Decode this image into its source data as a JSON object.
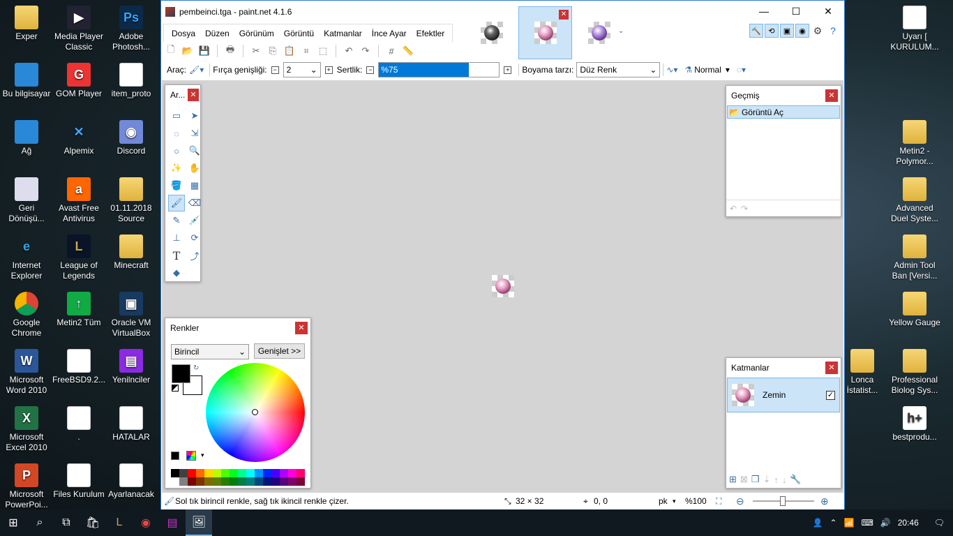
{
  "desktop_left": [
    {
      "label": "Exper",
      "icon": "folder-user-icon"
    },
    {
      "label": "Media Player Classic",
      "icon": "media-player-icon"
    },
    {
      "label": "Adobe Photosh...",
      "icon": "photoshop-icon"
    },
    {
      "label": "Bu bilgisayar",
      "icon": "computer-icon"
    },
    {
      "label": "GOM Player",
      "icon": "gom-player-icon"
    },
    {
      "label": "item_proto",
      "icon": "document-icon"
    },
    {
      "label": "Ağ",
      "icon": "network-icon"
    },
    {
      "label": "Alpemix",
      "icon": "alpemix-icon"
    },
    {
      "label": "Discord",
      "icon": "discord-icon"
    },
    {
      "label": "Geri Dönüşü...",
      "icon": "recycle-bin-icon"
    },
    {
      "label": "Avast Free Antivirus",
      "icon": "avast-icon"
    },
    {
      "label": "01.11.2018 Source",
      "icon": "folder-icon"
    },
    {
      "label": "Internet Explorer",
      "icon": "ie-icon"
    },
    {
      "label": "League of Legends",
      "icon": "lol-icon"
    },
    {
      "label": "Minecraft",
      "icon": "folder-icon"
    },
    {
      "label": "Google Chrome",
      "icon": "chrome-icon"
    },
    {
      "label": "Metin2 Tüm",
      "icon": "metin2-icon"
    },
    {
      "label": "Oracle VM VirtualBox",
      "icon": "virtualbox-icon"
    },
    {
      "label": "Microsoft Word 2010",
      "icon": "word-icon"
    },
    {
      "label": "FreeBSD9.2...",
      "icon": "document-icon"
    },
    {
      "label": "Yenilnciler",
      "icon": "winrar-icon"
    },
    {
      "label": "Microsoft Excel 2010",
      "icon": "excel-icon"
    },
    {
      "label": ".",
      "icon": "document-icon"
    },
    {
      "label": "HATALAR",
      "icon": "document-icon"
    },
    {
      "label": "Microsoft PowerPoi...",
      "icon": "powerpoint-icon"
    },
    {
      "label": "Files Kurulum",
      "icon": "document-icon"
    },
    {
      "label": "Ayarlanacak",
      "icon": "document-icon"
    }
  ],
  "desktop_right": [
    {
      "label": "Uyarı [ KURULUM...",
      "icon": "document-icon"
    },
    {
      "label": "Metin2 - Polymor...",
      "icon": "folder-icon"
    },
    {
      "label": "Advanced Duel Syste...",
      "icon": "folder-icon"
    },
    {
      "label": "Admin Tool Ban [Versi...",
      "icon": "folder-icon"
    },
    {
      "label": "Yellow Gauge",
      "icon": "folder-icon"
    },
    {
      "label": "Lonca İstatist...",
      "icon": "folder-icon"
    },
    {
      "label": "Professional Biolog Sys...",
      "icon": "folder-icon"
    },
    {
      "label": "bestprodu...",
      "icon": "hplus-icon"
    }
  ],
  "window": {
    "title": "pembeinci.tga - paint.net 4.1.6",
    "minimize": "—",
    "maximize": "☐",
    "close": "✕"
  },
  "menu": [
    "Dosya",
    "Düzen",
    "Görünüm",
    "Görüntü",
    "Katmanlar",
    "İnce Ayar",
    "Efektler"
  ],
  "toolbar2": {
    "tool_label": "Araç:",
    "brush_width_label": "Fırça genişliği:",
    "brush_width_value": "2",
    "hardness_label": "Sertlik:",
    "hardness_value": "%75",
    "hardness_fraction": 0.75,
    "fill_label": "Boyama tarzı:",
    "fill_value": "Düz Renk",
    "blend_value": "Normal"
  },
  "tools_panel": {
    "title": "Ar..."
  },
  "history_panel": {
    "title": "Geçmiş",
    "items": [
      "Görüntü Aç"
    ]
  },
  "colors_panel": {
    "title": "Renkler",
    "mode": "Birincil",
    "expand": "Genişlet >>"
  },
  "layers_panel": {
    "title": "Katmanlar",
    "layers": [
      {
        "name": "Zemin",
        "visible": true
      }
    ]
  },
  "status": {
    "hint": "Sol tık birincil renkle, sağ tık ikincil renkle çizer.",
    "size": "32 × 32",
    "position": "0, 0",
    "units": "pk",
    "zoom": "%100"
  },
  "palette": [
    "#000000",
    "#404040",
    "#ff0000",
    "#ff6a00",
    "#ffd800",
    "#b6ff00",
    "#4cff00",
    "#00ff21",
    "#00ff90",
    "#00ffff",
    "#0094ff",
    "#0026ff",
    "#4800ff",
    "#b200ff",
    "#ff00dc",
    "#ff006e"
  ],
  "palette_row2": [
    "#ffffff",
    "#808080",
    "#7f0000",
    "#7f3300",
    "#7f6a00",
    "#5b7f00",
    "#267f00",
    "#007f0e",
    "#007f46",
    "#007f7f",
    "#004a7f",
    "#00137f",
    "#21007f",
    "#57007f",
    "#7f006e",
    "#7f0037"
  ],
  "taskbar": {
    "time": "20:46"
  },
  "colors": {
    "accent": "#0078d7",
    "selection": "#cce4f7",
    "close_red": "#cc3333"
  }
}
